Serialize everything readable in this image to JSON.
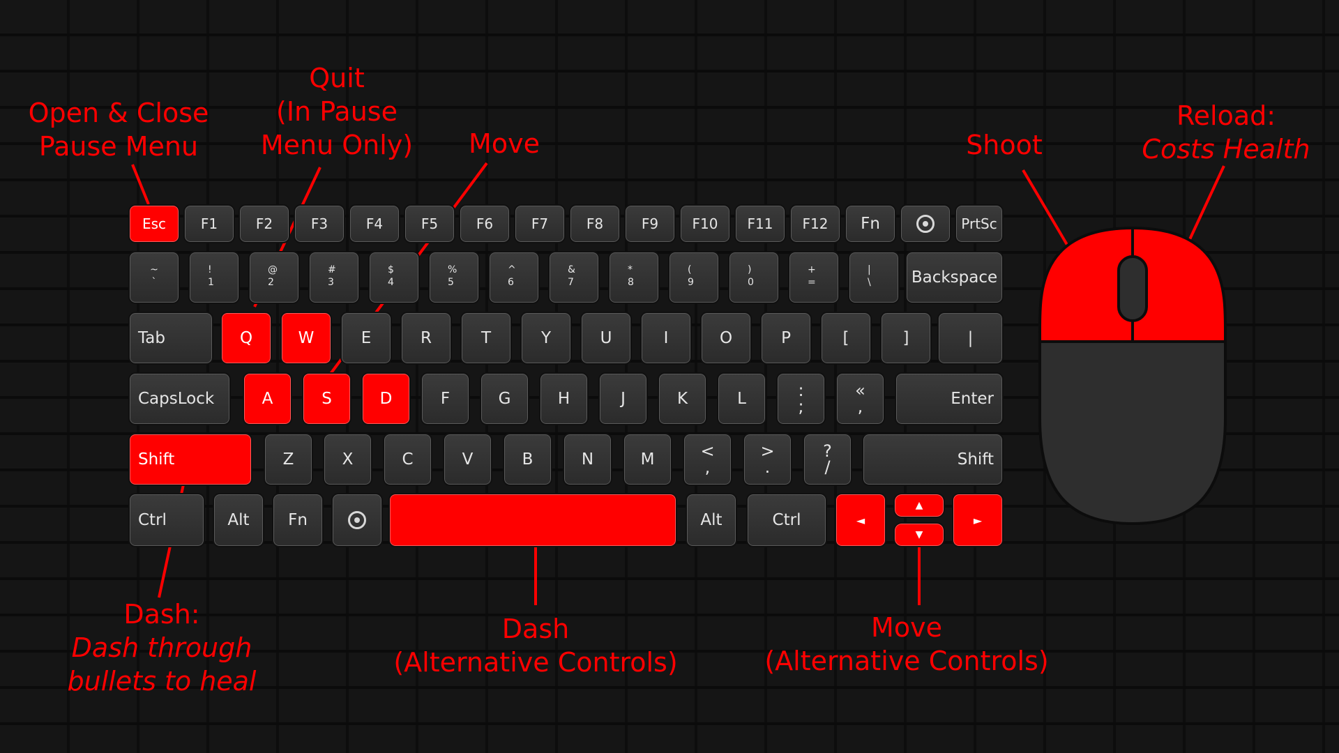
{
  "keyboard": {
    "function_row": [
      "Esc",
      "F1",
      "F2",
      "F3",
      "F4",
      "F5",
      "F6",
      "F7",
      "F8",
      "F9",
      "F10",
      "F11",
      "F12",
      "Fn",
      "",
      "PrtSc"
    ],
    "number_row": [
      {
        "top": "~",
        "bottom": "`"
      },
      {
        "top": "!",
        "bottom": "1"
      },
      {
        "top": "@",
        "bottom": "2"
      },
      {
        "top": "#",
        "bottom": "3"
      },
      {
        "top": "$",
        "bottom": "4"
      },
      {
        "top": "%",
        "bottom": "5"
      },
      {
        "top": "^",
        "bottom": "6"
      },
      {
        "top": "&",
        "bottom": "7"
      },
      {
        "top": "*",
        "bottom": "8"
      },
      {
        "top": "(",
        "bottom": "9"
      },
      {
        "top": ")",
        "bottom": "0"
      },
      {
        "top": "+",
        "bottom": "="
      },
      {
        "top": "|",
        "bottom": "\\"
      }
    ],
    "backspace": "Backspace",
    "tab": "Tab",
    "qwerty_row": [
      "Q",
      "W",
      "E",
      "R",
      "T",
      "Y",
      "U",
      "I",
      "O",
      "P",
      "[",
      "]",
      "|"
    ],
    "capslock": "CapsLock",
    "home_row": [
      "A",
      "S",
      "D",
      "F",
      "G",
      "H",
      "J",
      "K",
      "L"
    ],
    "semicolon": {
      "top": ":",
      "bottom": ";"
    },
    "quote": {
      "top": "«",
      "bottom": ","
    },
    "enter": "Enter",
    "shift_left": "Shift",
    "bottom_letters": [
      "Z",
      "X",
      "C",
      "V",
      "B",
      "N",
      "M"
    ],
    "comma": {
      "top": "<",
      "bottom": ","
    },
    "period": {
      "top": ">",
      "bottom": "."
    },
    "slash": {
      "top": "?",
      "bottom": "/"
    },
    "shift_right": "Shift",
    "ctrl_left": "Ctrl",
    "alt_left": "Alt",
    "fn": "Fn",
    "alt_right": "Alt",
    "ctrl_right": "Ctrl",
    "arrows": {
      "left": "◄",
      "up": "▲",
      "down": "▼",
      "right": "►"
    },
    "highlighted_keys": [
      "Esc",
      "Q",
      "W",
      "A",
      "S",
      "D",
      "Shift-left",
      "Space",
      "Arrows"
    ],
    "highlight_color": "#ff0000",
    "icons": [
      "gear-icon"
    ]
  },
  "annotations": {
    "pause": {
      "line1": "Open & Close",
      "line2": "Pause Menu"
    },
    "quit": {
      "line1": "Quit",
      "line2": "(In Pause",
      "line3": "Menu Only)"
    },
    "move": "Move",
    "shoot": "Shoot",
    "reload": {
      "line1": "Reload:",
      "line2": "Costs Health"
    },
    "dash": {
      "line1": "Dash:",
      "line2": "Dash through",
      "line3": "bullets to heal"
    },
    "dash_alt": {
      "line1": "Dash",
      "line2": "(Alternative Controls)"
    },
    "move_alt": {
      "line1": "Move",
      "line2": "(Alternative Controls)"
    }
  }
}
